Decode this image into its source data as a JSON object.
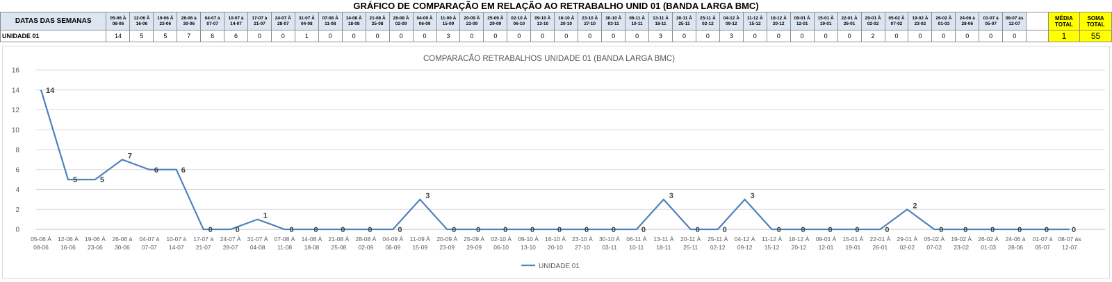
{
  "sheet": {
    "title": "GRÁFICO DE COMPARAÇÃO EM RELAÇÃO AO RETRABALHO UNID 01 (BANDA LARGA BMC)",
    "row_header_label": "DATAS DAS SEMANAS",
    "row_label": "UNIDADE 01",
    "weeks": [
      [
        "05-06 À",
        "08-06"
      ],
      [
        "12-06 À",
        "16-06"
      ],
      [
        "19-06 À",
        "23-06"
      ],
      [
        "26-06 à",
        "30-06"
      ],
      [
        "04-07 à",
        "07-07"
      ],
      [
        "10-07 à",
        "14-07"
      ],
      [
        "17-07 à",
        "21-07"
      ],
      [
        "24-07 À",
        "28-07"
      ],
      [
        "31-07 À",
        "04-08"
      ],
      [
        "07-08 À",
        "11-08"
      ],
      [
        "14-08 À",
        "18-08"
      ],
      [
        "21-08 À",
        "25-08"
      ],
      [
        "28-08 À",
        "02-09"
      ],
      [
        "04-09 À",
        "06-09"
      ],
      [
        "11-09 À",
        "15-09"
      ],
      [
        "20-09 À",
        "23-09"
      ],
      [
        "25-09 À",
        "29-09"
      ],
      [
        "02-10 À",
        "06-10"
      ],
      [
        "09-10 À",
        "13-10"
      ],
      [
        "16-10 À",
        "20-10"
      ],
      [
        "23-10 À",
        "27-10"
      ],
      [
        "30-10 À",
        "03-11"
      ],
      [
        "06-11 À",
        "10-11"
      ],
      [
        "13-11 À",
        "18-11"
      ],
      [
        "20-11 À",
        "25-11"
      ],
      [
        "25-11 À",
        "02-12"
      ],
      [
        "04-12 À",
        "09-12"
      ],
      [
        "11-12 À",
        "15-12"
      ],
      [
        "18-12 À",
        "20-12"
      ],
      [
        "09-01 À",
        "12-01"
      ],
      [
        "15-01 À",
        "19-01"
      ],
      [
        "22-01 À",
        "26-01"
      ],
      [
        "29-01 À",
        "02-02"
      ],
      [
        "05-02 À",
        "07-02"
      ],
      [
        "19-02 À",
        "23-02"
      ],
      [
        "26-02 À",
        "01-03"
      ],
      [
        "24-06 à",
        "28-06"
      ],
      [
        "01-07 à",
        "05-07"
      ],
      [
        "08-07 às",
        "12-07"
      ]
    ],
    "values": [
      14,
      5,
      5,
      7,
      6,
      6,
      0,
      0,
      1,
      0,
      0,
      0,
      0,
      0,
      3,
      0,
      0,
      0,
      0,
      0,
      0,
      0,
      0,
      3,
      0,
      0,
      3,
      0,
      0,
      0,
      0,
      0,
      2,
      0,
      0,
      0,
      0,
      0,
      0
    ],
    "media_label": [
      "MÉDIA",
      "TOTAL"
    ],
    "media_value": "1",
    "soma_label": [
      "SOMA",
      "TOTAL"
    ],
    "soma_value": "55"
  },
  "chart_data": {
    "type": "line",
    "title": "COMPARACÃO RETRABALHOS UNIDADE 01 (BANDA LARGA BMC)",
    "categories": [
      [
        "05-06 À",
        "08-06"
      ],
      [
        "12-06 À",
        "16-06"
      ],
      [
        "19-06 À",
        "23-06"
      ],
      [
        "26-06 à",
        "30-06"
      ],
      [
        "04-07 à",
        "07-07"
      ],
      [
        "10-07 à",
        "14-07"
      ],
      [
        "17-07 à",
        "21-07"
      ],
      [
        "24-07 À",
        "28-07"
      ],
      [
        "31-07 À",
        "04-08"
      ],
      [
        "07-08 À",
        "11-08"
      ],
      [
        "14-08 À",
        "18-08"
      ],
      [
        "21-08 À",
        "25-08"
      ],
      [
        "28-08 À",
        "02-09"
      ],
      [
        "04-09 À",
        "06-09"
      ],
      [
        "11-09 À",
        "15-09"
      ],
      [
        "20-09 À",
        "23-09"
      ],
      [
        "25-09 À",
        "29-09"
      ],
      [
        "02-10 À",
        "06-10"
      ],
      [
        "09-10 À",
        "13-10"
      ],
      [
        "16-10 À",
        "20-10"
      ],
      [
        "23-10 À",
        "27-10"
      ],
      [
        "30-10 À",
        "03-11"
      ],
      [
        "06-11 À",
        "10-11"
      ],
      [
        "13-11 À",
        "18-11"
      ],
      [
        "20-11 À",
        "25-11"
      ],
      [
        "25-11 À",
        "02-12"
      ],
      [
        "04-12 À",
        "09-12"
      ],
      [
        "11-12 À",
        "15-12"
      ],
      [
        "18-12 À",
        "20-12"
      ],
      [
        "09-01 À",
        "12-01"
      ],
      [
        "15-01 À",
        "19-01"
      ],
      [
        "22-01 À",
        "26-01"
      ],
      [
        "29-01 À",
        "02-02"
      ],
      [
        "05-02 À",
        "07-02"
      ],
      [
        "19-02 À",
        "23-02"
      ],
      [
        "26-02 À",
        "01-03"
      ],
      [
        "24-06 à",
        "28-06"
      ],
      [
        "01-07 à",
        "05-07"
      ],
      [
        "08-07 às",
        "12-07"
      ]
    ],
    "series": [
      {
        "name": "UNIDADE 01",
        "values": [
          14,
          5,
          5,
          7,
          6,
          6,
          0,
          0,
          1,
          0,
          0,
          0,
          0,
          0,
          3,
          0,
          0,
          0,
          0,
          0,
          0,
          0,
          0,
          3,
          0,
          0,
          3,
          0,
          0,
          0,
          0,
          0,
          2,
          0,
          0,
          0,
          0,
          0,
          0
        ]
      }
    ],
    "ylim": [
      0,
      16
    ],
    "yticks": [
      0,
      2,
      4,
      6,
      8,
      10,
      12,
      14,
      16
    ],
    "grid": true,
    "legend": "bottom",
    "colors": {
      "line": "#4f81bd",
      "grid": "#d9d9d9",
      "axis_text": "#595959",
      "label_text": "#404040"
    }
  }
}
